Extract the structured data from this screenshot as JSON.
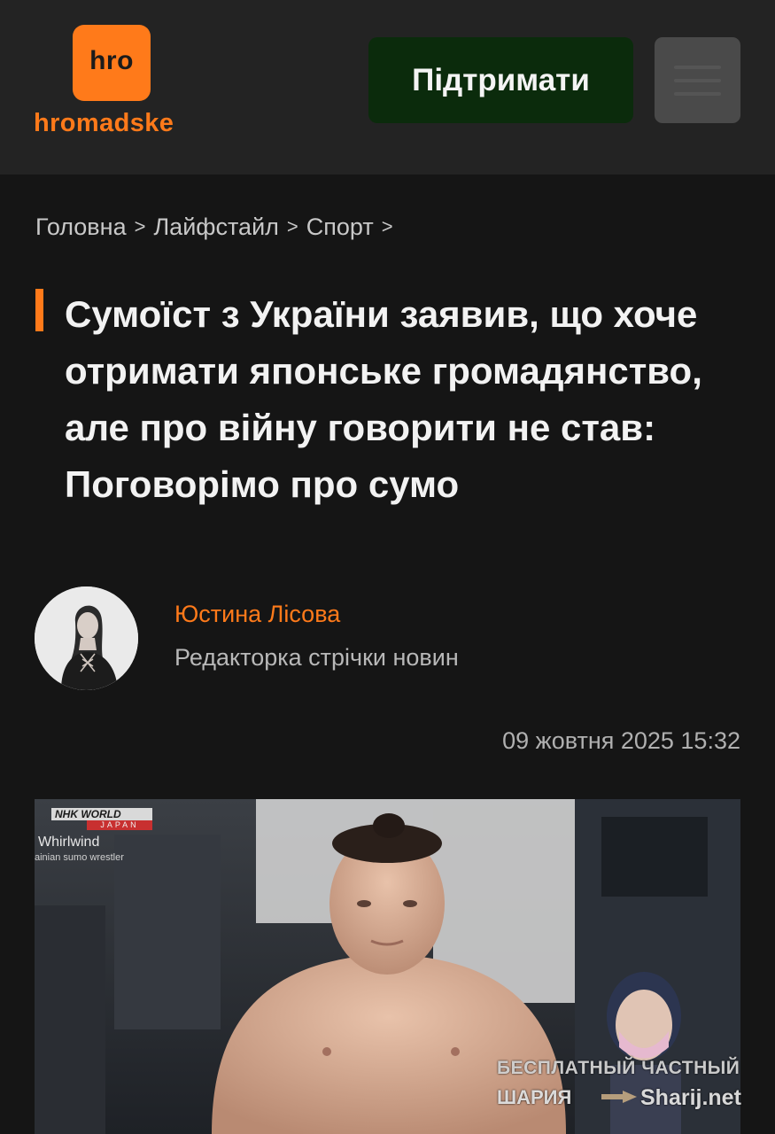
{
  "header": {
    "logo_tile_text": "hro",
    "logo_word": "hromadske",
    "support_label": "Підтримати",
    "menu_icon": "hamburger-menu-icon"
  },
  "breadcrumb": {
    "items": [
      "Головна",
      "Лайфстайл",
      "Спорт"
    ],
    "separator": ">"
  },
  "article": {
    "title": "Сумоїст з України заявив, що хоче отримати японське громадянство, але про війну говорити не став: Поговорімо про сумо",
    "author_name": "Юстина Лісова",
    "author_role": "Редакторка стрічки новин",
    "date": "09 жовтня 2025 15:32"
  },
  "photo": {
    "broadcaster": "NHK WORLD",
    "broadcaster_sub": "JAPAN",
    "caption_line1": "Whirlwind",
    "caption_line2": "ainian sumo wrestler"
  },
  "watermark": {
    "line1": "БЕСПЛАТНЫЙ  ЧАСТНЫЙ",
    "line2": "ШАРИЯ",
    "site": "Sharij.net"
  },
  "colors": {
    "accent": "#ff7a1a",
    "header_bg": "#232323",
    "page_bg": "#151515",
    "support_bg": "#0b2b0c",
    "menu_bg": "#4a4a4a"
  }
}
